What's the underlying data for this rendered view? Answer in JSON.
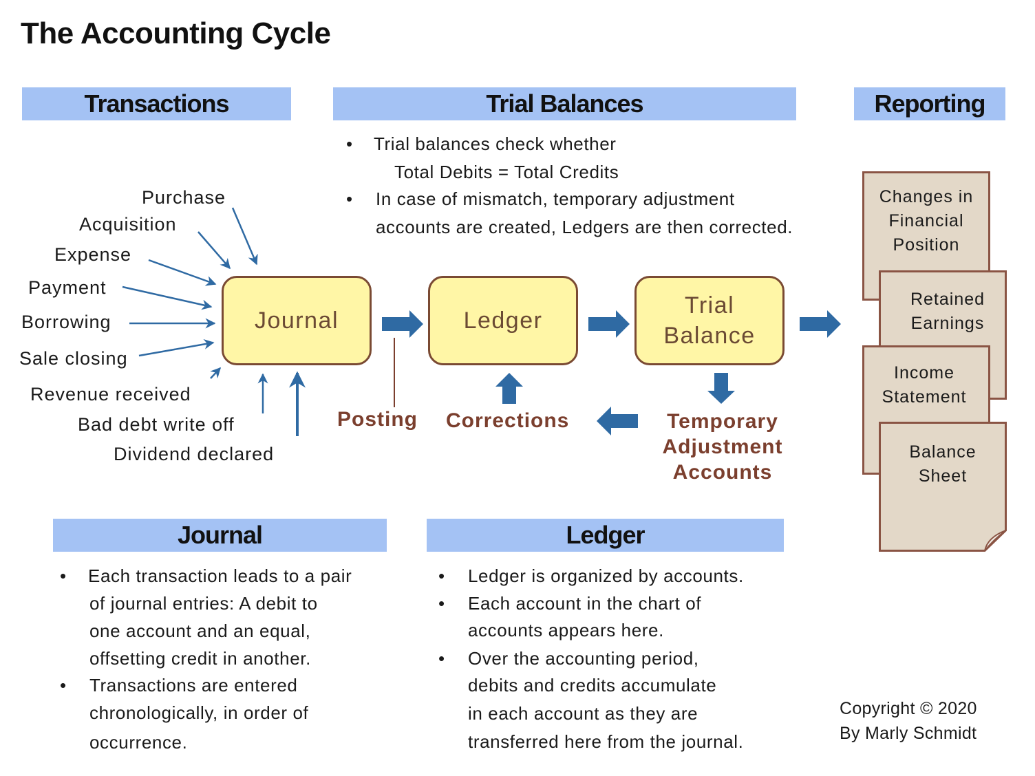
{
  "title": "The Accounting Cycle",
  "sections": {
    "transactions": "Transactions",
    "trial_balances": "Trial Balances",
    "reporting": "Reporting",
    "journal": "Journal",
    "ledger": "Ledger"
  },
  "trial_balances_notes": {
    "bullet_1": [
      "Trial balances check whether",
      "Total Debits = Total Credits"
    ],
    "bullet_2": [
      "In case of mismatch, temporary adjustment",
      "accounts are created, Ledgers are then corrected."
    ]
  },
  "transactions": [
    "Purchase",
    "Acquisition",
    "Expense",
    "Payment",
    "Borrowing",
    "Sale closing",
    "Revenue received",
    "Bad debt write off",
    "Dividend declared"
  ],
  "flow_nodes": {
    "journal": "Journal",
    "ledger": "Ledger",
    "trial_balance": [
      "Trial",
      "Balance"
    ]
  },
  "flow_labels": {
    "posting": "Posting",
    "corrections": "Corrections",
    "temporary_adjustment": [
      "Temporary",
      "Adjustment",
      "Accounts"
    ]
  },
  "reports": [
    {
      "lines": [
        "Changes in",
        "Financial",
        "Position"
      ]
    },
    {
      "lines": [
        "Retained",
        "Earnings"
      ]
    },
    {
      "lines": [
        "Income",
        "Statement"
      ]
    },
    {
      "lines": [
        "Balance",
        "Sheet"
      ]
    }
  ],
  "journal_notes": {
    "bullet_1": [
      "Each transaction leads to a pair",
      "of journal entries: A debit to",
      "one account and an equal,",
      "offsetting credit in another."
    ],
    "bullet_2": [
      "Transactions are entered",
      "chronologically, in order of",
      "occurrence."
    ]
  },
  "ledger_notes": {
    "bullet_1": [
      "Ledger is organized by accounts."
    ],
    "bullet_2": [
      "Each account in the chart of",
      "accounts appears here."
    ],
    "bullet_3": [
      "Over the accounting period,",
      "debits and credits accumulate",
      "in each account as they are",
      "transferred here from the journal."
    ]
  },
  "copyright": [
    "Copyright © 2020",
    "By Marly Schmidt"
  ],
  "colors": {
    "band": "#a4c2f4",
    "node_fill": "#fff6a6",
    "node_border": "#7a4a33",
    "arrow": "#2f6aa3",
    "label_brown": "#7b3f2e",
    "doc_fill": "#e3d8c8",
    "doc_border": "#8a5444"
  }
}
